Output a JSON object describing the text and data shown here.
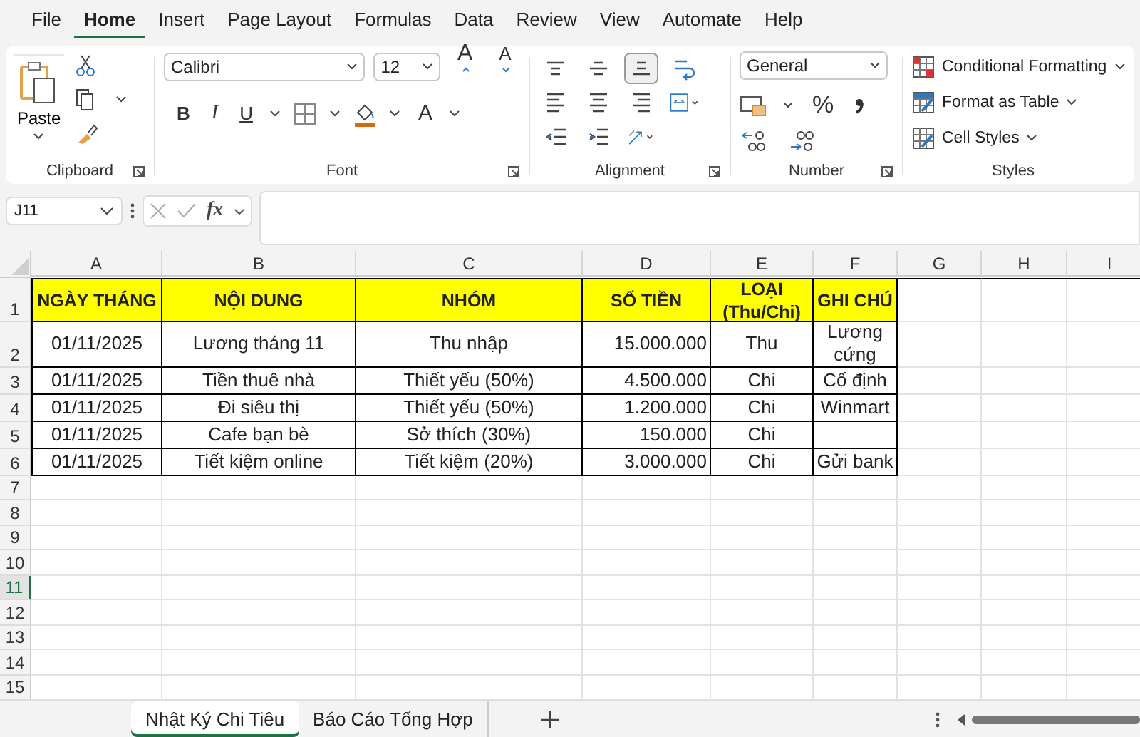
{
  "menu": [
    {
      "label": "File",
      "selected": false
    },
    {
      "label": "Home",
      "selected": true
    },
    {
      "label": "Insert",
      "selected": false
    },
    {
      "label": "Page Layout",
      "selected": false
    },
    {
      "label": "Formulas",
      "selected": false
    },
    {
      "label": "Data",
      "selected": false
    },
    {
      "label": "Review",
      "selected": false
    },
    {
      "label": "View",
      "selected": false
    },
    {
      "label": "Automate",
      "selected": false
    },
    {
      "label": "Help",
      "selected": false
    }
  ],
  "ribbon": {
    "clipboard": {
      "label": "Clipboard",
      "paste": "Paste"
    },
    "font": {
      "label": "Font",
      "name": "Calibri",
      "size": "12",
      "grow": "A",
      "shrink": "A",
      "bold": "B",
      "italic": "I",
      "underline": "U",
      "font_color_button": "A"
    },
    "alignment": {
      "label": "Alignment",
      "buttons": [
        {
          "kind": "top",
          "selected": false
        },
        {
          "kind": "middle",
          "selected": false
        },
        {
          "kind": "bottom",
          "selected": true
        },
        {
          "kind": "wrap",
          "selected": false
        },
        {
          "kind": "left",
          "selected": false
        },
        {
          "kind": "center",
          "selected": false
        },
        {
          "kind": "right",
          "selected": false
        },
        {
          "kind": "merge",
          "selected": false
        },
        {
          "kind": "outdent",
          "selected": false
        },
        {
          "kind": "indent",
          "selected": false
        },
        {
          "kind": "orientation",
          "selected": false
        }
      ]
    },
    "number": {
      "label": "Number",
      "format": "General",
      "percent": "%"
    },
    "styles": {
      "label": "Styles",
      "items": [
        {
          "kind": "conditional",
          "label": "Conditional Formatting"
        },
        {
          "kind": "table",
          "label": "Format as Table"
        },
        {
          "kind": "cell",
          "label": "Cell Styles"
        }
      ]
    }
  },
  "formula_bar": {
    "name_box": "J11",
    "function_label": "fx"
  },
  "sheet": {
    "columns": [
      "A",
      "B",
      "C",
      "D",
      "E",
      "F",
      "G",
      "H",
      "I"
    ],
    "rows": [
      {
        "number": "1",
        "selected": false,
        "kind": "header",
        "cells": [
          "NGÀY THÁNG",
          "NỘI DUNG",
          "NHÓM",
          "SỐ TIỀN",
          "LOẠI (Thu/Chi)",
          "GHI CHÚ"
        ]
      },
      {
        "number": "2",
        "selected": false,
        "kind": "data",
        "cells": [
          "01/11/2025",
          "Lương tháng 11",
          "Thu nhập",
          "15.000.000",
          "Thu",
          "Lương cứng"
        ]
      },
      {
        "number": "3",
        "selected": false,
        "kind": "data",
        "cells": [
          "01/11/2025",
          "Tiền thuê nhà",
          "Thiết yếu (50%)",
          "4.500.000",
          "Chi",
          "Cố định"
        ]
      },
      {
        "number": "4",
        "selected": false,
        "kind": "data",
        "cells": [
          "01/11/2025",
          "Đi siêu thị",
          "Thiết yếu (50%)",
          "1.200.000",
          "Chi",
          "Winmart"
        ]
      },
      {
        "number": "5",
        "selected": false,
        "kind": "data",
        "cells": [
          "01/11/2025",
          "Cafe bạn bè",
          "Sở thích (30%)",
          "150.000",
          "Chi",
          null
        ]
      },
      {
        "number": "6",
        "selected": false,
        "kind": "data",
        "cells": [
          "01/11/2025",
          "Tiết kiệm online",
          "Tiết kiệm (20%)",
          "3.000.000",
          "Chi",
          "Gửi bank"
        ]
      },
      {
        "number": "7",
        "selected": false
      },
      {
        "number": "8",
        "selected": false
      },
      {
        "number": "9",
        "selected": false
      },
      {
        "number": "10",
        "selected": false
      },
      {
        "number": "11",
        "selected": true
      },
      {
        "number": "12",
        "selected": false
      },
      {
        "number": "13",
        "selected": false
      },
      {
        "number": "14",
        "selected": false
      },
      {
        "number": "15",
        "selected": false
      }
    ]
  },
  "sheet_tabs": [
    {
      "label": "Nhật Ký Chi Tiêu",
      "selected": true
    },
    {
      "label": "Báo Cáo Tổng Hợp",
      "selected": false
    }
  ]
}
